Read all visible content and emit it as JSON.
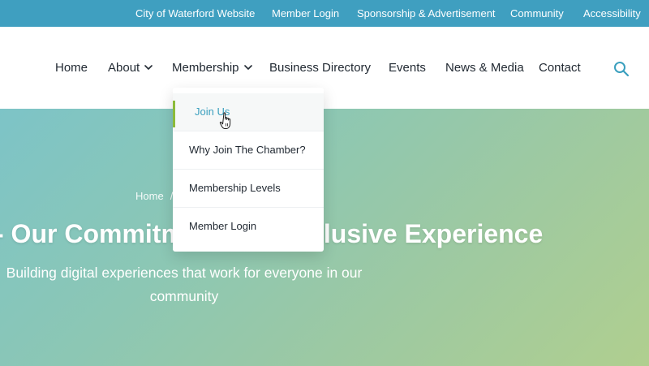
{
  "topbar": {
    "links": [
      "City of Waterford Website",
      "Member Login",
      "Sponsorship & Advertisement",
      "Community",
      "Accessibility"
    ]
  },
  "nav": {
    "home": "Home",
    "about": "About",
    "membership": "Membership",
    "business_directory": "Business Directory",
    "events": "Events",
    "news_media": "News & Media",
    "contact": "Contact",
    "search_icon": "search-icon"
  },
  "dropdown": {
    "items": [
      "Join Us",
      "Why Join The Chamber?",
      "Membership Levels",
      "Member Login"
    ],
    "active_index": 0
  },
  "hero": {
    "breadcrumb_home": "Home",
    "breadcrumb_sep": "/",
    "title_left": "- Our Commitm",
    "title_right": "lusive Experience",
    "subtitle": "Building digital experiences that work for everyone in our community"
  },
  "colors": {
    "topbar_bg": "#3f9fc0",
    "accent": "#3a9fbe",
    "active_marker": "#8cbb3a",
    "nav_text": "#222a33"
  }
}
